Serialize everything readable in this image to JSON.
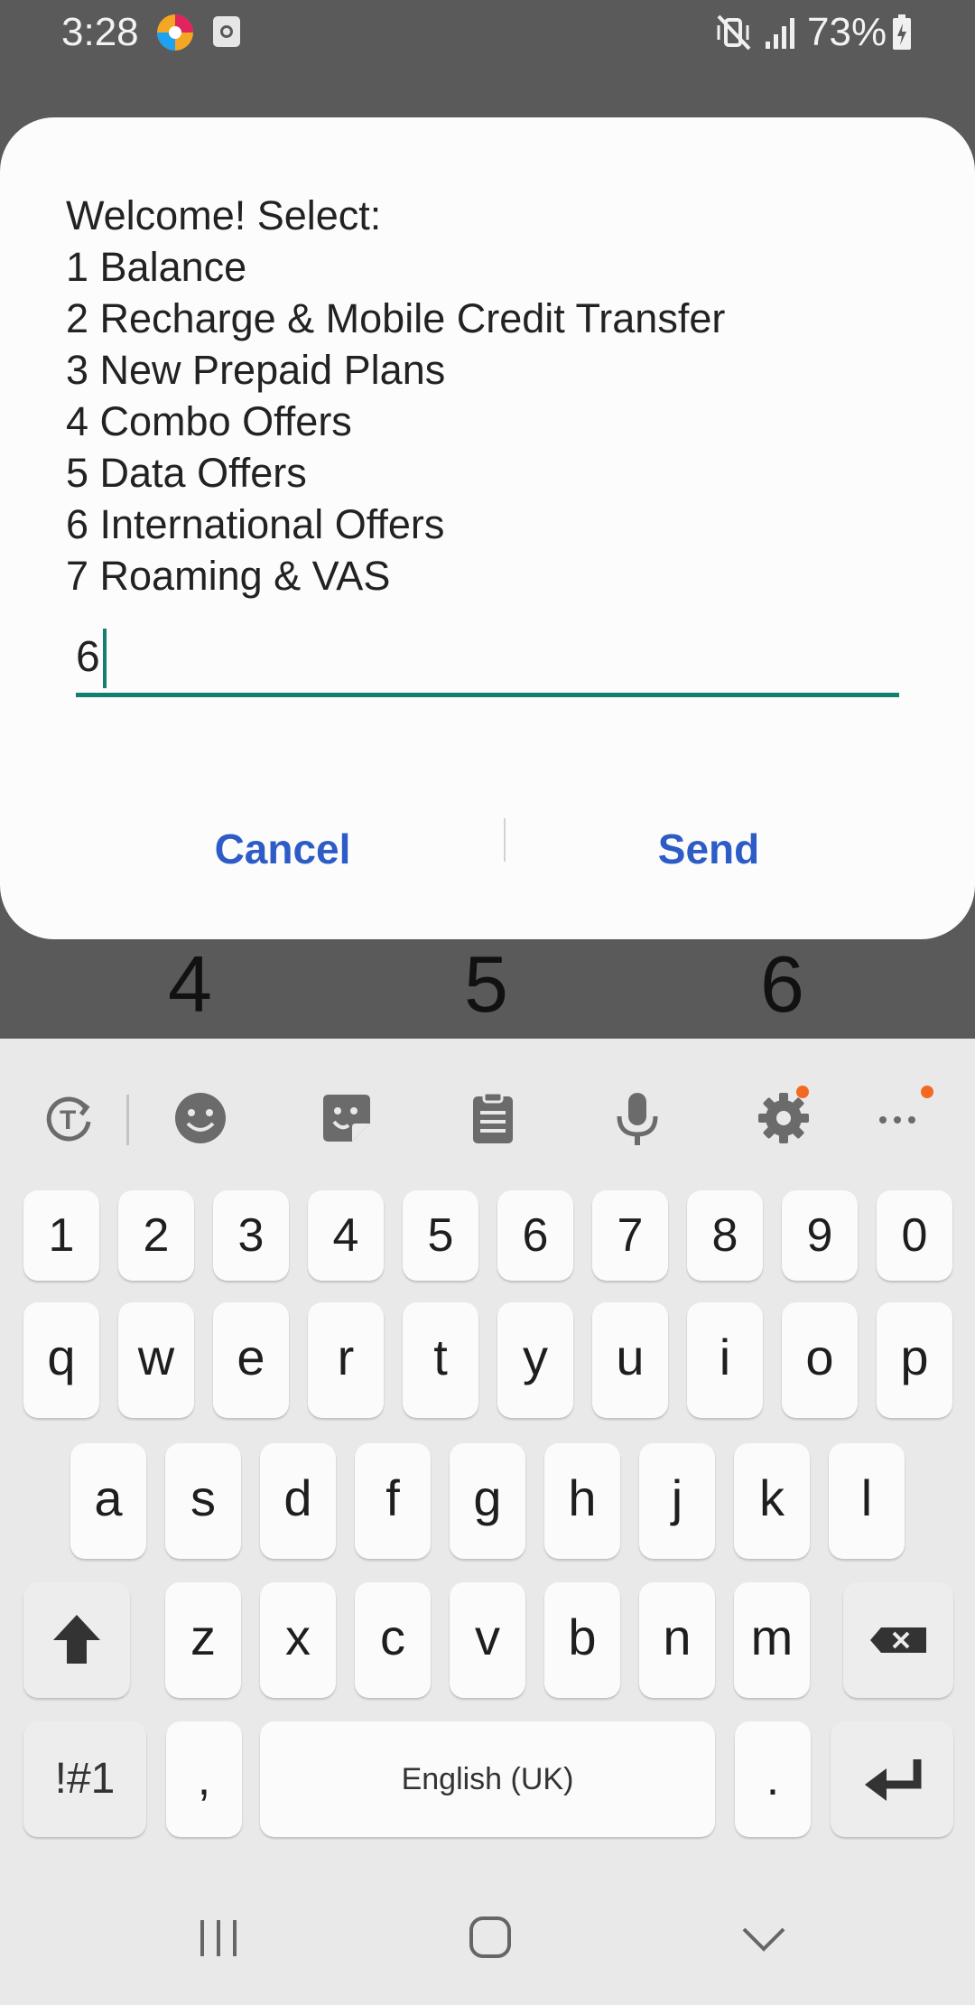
{
  "status_bar": {
    "time": "3:28",
    "battery_percent": "73%",
    "icons": [
      "app-notification-icon",
      "clock-icon",
      "vibrate-mute-icon",
      "signal-icon",
      "battery-charging-icon"
    ]
  },
  "keyboard_preview": {
    "digits": [
      "4",
      "5",
      "6"
    ]
  },
  "dialog": {
    "message_lines": [
      "Welcome! Select:",
      "1 Balance",
      "2 Recharge & Mobile Credit Transfer",
      "3 New Prepaid Plans",
      "4 Combo Offers",
      "5 Data Offers",
      "6 International Offers",
      "7 Roaming & VAS"
    ],
    "input_value": "6",
    "cancel_label": "Cancel",
    "send_label": "Send"
  },
  "keyboard": {
    "toolbar_icons": [
      "translate-icon",
      "emoji-icon",
      "sticker-icon",
      "clipboard-icon",
      "microphone-icon",
      "settings-icon",
      "more-icon"
    ],
    "number_row": [
      "1",
      "2",
      "3",
      "4",
      "5",
      "6",
      "7",
      "8",
      "9",
      "0"
    ],
    "row1": [
      "q",
      "w",
      "e",
      "r",
      "t",
      "y",
      "u",
      "i",
      "o",
      "p"
    ],
    "row2": [
      "a",
      "s",
      "d",
      "f",
      "g",
      "h",
      "j",
      "k",
      "l"
    ],
    "row3": [
      "z",
      "x",
      "c",
      "v",
      "b",
      "n",
      "m"
    ],
    "symbols_label": "!#1",
    "comma_label": ",",
    "space_label": "English (UK)",
    "period_label": ".",
    "accent_color": "#f26a21"
  },
  "nav_bar": {
    "icons": [
      "recents-icon",
      "home-icon",
      "back-icon"
    ]
  },
  "colors": {
    "dialog_button": "#2d5cc7",
    "input_underline": "#137f6f"
  }
}
